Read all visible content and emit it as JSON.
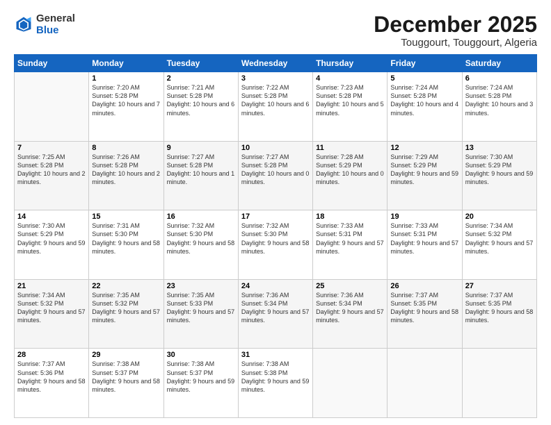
{
  "logo": {
    "line1": "General",
    "line2": "Blue"
  },
  "title": "December 2025",
  "subtitle": "Touggourt, Touggourt, Algeria",
  "days_header": [
    "Sunday",
    "Monday",
    "Tuesday",
    "Wednesday",
    "Thursday",
    "Friday",
    "Saturday"
  ],
  "weeks": [
    [
      {
        "day": "",
        "info": ""
      },
      {
        "day": "1",
        "info": "Sunrise: 7:20 AM\nSunset: 5:28 PM\nDaylight: 10 hours\nand 7 minutes."
      },
      {
        "day": "2",
        "info": "Sunrise: 7:21 AM\nSunset: 5:28 PM\nDaylight: 10 hours\nand 6 minutes."
      },
      {
        "day": "3",
        "info": "Sunrise: 7:22 AM\nSunset: 5:28 PM\nDaylight: 10 hours\nand 6 minutes."
      },
      {
        "day": "4",
        "info": "Sunrise: 7:23 AM\nSunset: 5:28 PM\nDaylight: 10 hours\nand 5 minutes."
      },
      {
        "day": "5",
        "info": "Sunrise: 7:24 AM\nSunset: 5:28 PM\nDaylight: 10 hours\nand 4 minutes."
      },
      {
        "day": "6",
        "info": "Sunrise: 7:24 AM\nSunset: 5:28 PM\nDaylight: 10 hours\nand 3 minutes."
      }
    ],
    [
      {
        "day": "7",
        "info": "Sunrise: 7:25 AM\nSunset: 5:28 PM\nDaylight: 10 hours\nand 2 minutes."
      },
      {
        "day": "8",
        "info": "Sunrise: 7:26 AM\nSunset: 5:28 PM\nDaylight: 10 hours\nand 2 minutes."
      },
      {
        "day": "9",
        "info": "Sunrise: 7:27 AM\nSunset: 5:28 PM\nDaylight: 10 hours\nand 1 minute."
      },
      {
        "day": "10",
        "info": "Sunrise: 7:27 AM\nSunset: 5:28 PM\nDaylight: 10 hours\nand 0 minutes."
      },
      {
        "day": "11",
        "info": "Sunrise: 7:28 AM\nSunset: 5:29 PM\nDaylight: 10 hours\nand 0 minutes."
      },
      {
        "day": "12",
        "info": "Sunrise: 7:29 AM\nSunset: 5:29 PM\nDaylight: 9 hours\nand 59 minutes."
      },
      {
        "day": "13",
        "info": "Sunrise: 7:30 AM\nSunset: 5:29 PM\nDaylight: 9 hours\nand 59 minutes."
      }
    ],
    [
      {
        "day": "14",
        "info": "Sunrise: 7:30 AM\nSunset: 5:29 PM\nDaylight: 9 hours\nand 59 minutes."
      },
      {
        "day": "15",
        "info": "Sunrise: 7:31 AM\nSunset: 5:30 PM\nDaylight: 9 hours\nand 58 minutes."
      },
      {
        "day": "16",
        "info": "Sunrise: 7:32 AM\nSunset: 5:30 PM\nDaylight: 9 hours\nand 58 minutes."
      },
      {
        "day": "17",
        "info": "Sunrise: 7:32 AM\nSunset: 5:30 PM\nDaylight: 9 hours\nand 58 minutes."
      },
      {
        "day": "18",
        "info": "Sunrise: 7:33 AM\nSunset: 5:31 PM\nDaylight: 9 hours\nand 57 minutes."
      },
      {
        "day": "19",
        "info": "Sunrise: 7:33 AM\nSunset: 5:31 PM\nDaylight: 9 hours\nand 57 minutes."
      },
      {
        "day": "20",
        "info": "Sunrise: 7:34 AM\nSunset: 5:32 PM\nDaylight: 9 hours\nand 57 minutes."
      }
    ],
    [
      {
        "day": "21",
        "info": "Sunrise: 7:34 AM\nSunset: 5:32 PM\nDaylight: 9 hours\nand 57 minutes."
      },
      {
        "day": "22",
        "info": "Sunrise: 7:35 AM\nSunset: 5:32 PM\nDaylight: 9 hours\nand 57 minutes."
      },
      {
        "day": "23",
        "info": "Sunrise: 7:35 AM\nSunset: 5:33 PM\nDaylight: 9 hours\nand 57 minutes."
      },
      {
        "day": "24",
        "info": "Sunrise: 7:36 AM\nSunset: 5:34 PM\nDaylight: 9 hours\nand 57 minutes."
      },
      {
        "day": "25",
        "info": "Sunrise: 7:36 AM\nSunset: 5:34 PM\nDaylight: 9 hours\nand 57 minutes."
      },
      {
        "day": "26",
        "info": "Sunrise: 7:37 AM\nSunset: 5:35 PM\nDaylight: 9 hours\nand 58 minutes."
      },
      {
        "day": "27",
        "info": "Sunrise: 7:37 AM\nSunset: 5:35 PM\nDaylight: 9 hours\nand 58 minutes."
      }
    ],
    [
      {
        "day": "28",
        "info": "Sunrise: 7:37 AM\nSunset: 5:36 PM\nDaylight: 9 hours\nand 58 minutes."
      },
      {
        "day": "29",
        "info": "Sunrise: 7:38 AM\nSunset: 5:37 PM\nDaylight: 9 hours\nand 58 minutes."
      },
      {
        "day": "30",
        "info": "Sunrise: 7:38 AM\nSunset: 5:37 PM\nDaylight: 9 hours\nand 59 minutes."
      },
      {
        "day": "31",
        "info": "Sunrise: 7:38 AM\nSunset: 5:38 PM\nDaylight: 9 hours\nand 59 minutes."
      },
      {
        "day": "",
        "info": ""
      },
      {
        "day": "",
        "info": ""
      },
      {
        "day": "",
        "info": ""
      }
    ]
  ]
}
